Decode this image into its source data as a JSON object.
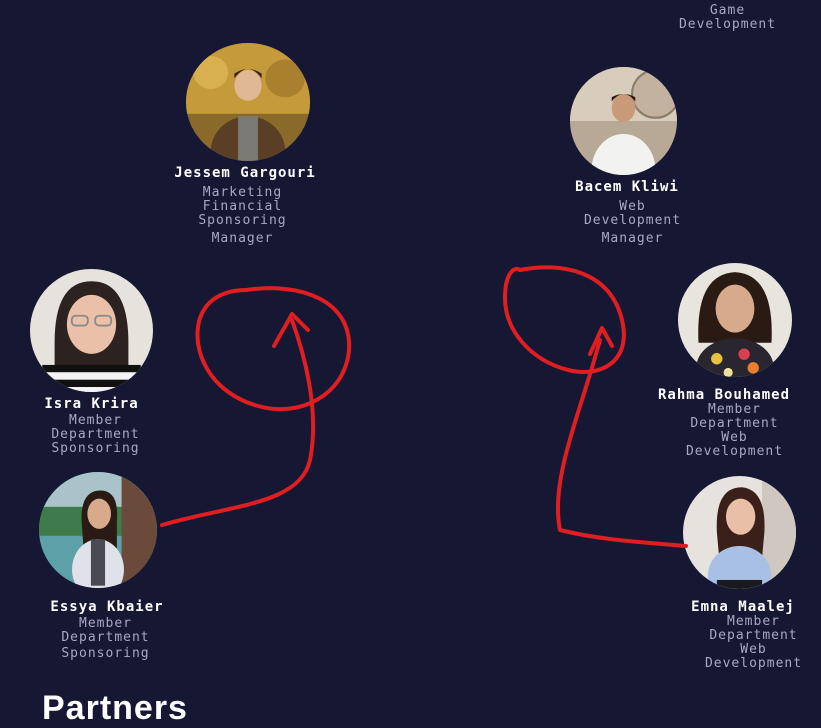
{
  "team": {
    "top_right_partial": {
      "lines": [
        "Game",
        "Development"
      ]
    },
    "jessem": {
      "name": "Jessem Gargouri",
      "lines": [
        "Marketing",
        "Financial",
        "Sponsoring",
        "Manager"
      ]
    },
    "bacem": {
      "name": "Bacem Kliwi",
      "lines": [
        "Web",
        "Development",
        "Manager"
      ]
    },
    "isra": {
      "name": "Isra Krira",
      "lines": [
        "Member",
        "Department",
        "Sponsoring"
      ]
    },
    "rahma": {
      "name": "Rahma Bouhamed",
      "lines": [
        "Member",
        "Department",
        "Web",
        "Development"
      ]
    },
    "essya": {
      "name": "Essya Kbaier",
      "lines": [
        "Member",
        "Department",
        "Sponsoring"
      ]
    },
    "emna": {
      "name": "Emna Maalej",
      "lines": [
        "Member",
        "Department",
        "Web",
        "Development"
      ]
    }
  },
  "partners_heading": "Partners",
  "colors": {
    "background": "#161733",
    "name_text": "#ffffff",
    "role_text": "#a7a9c2",
    "annotation": "#e01e22"
  },
  "icons": {
    "avatar": "person-photo"
  }
}
